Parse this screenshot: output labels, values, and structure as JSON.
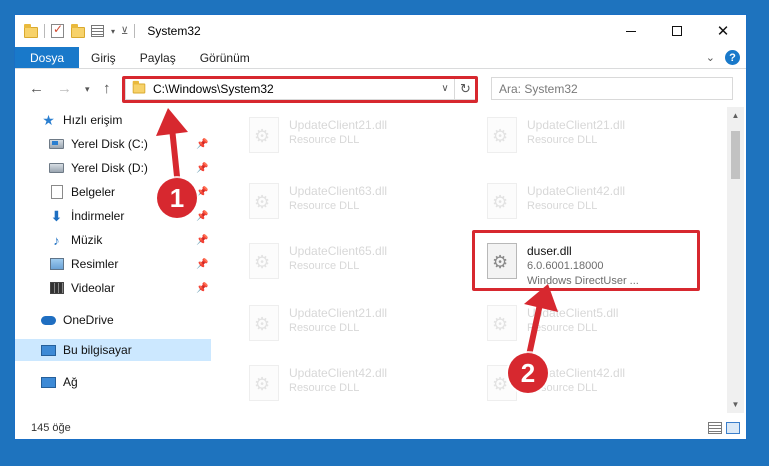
{
  "window": {
    "title": "System32"
  },
  "ribbon": {
    "tabs": [
      "Dosya",
      "Giriş",
      "Paylaş",
      "Görünüm"
    ],
    "help": "?"
  },
  "nav": {
    "address": "C:\\Windows\\System32",
    "search_placeholder": "Ara: System32"
  },
  "sidebar": {
    "quick_access": "Hızlı erişim",
    "items": [
      {
        "label": "Yerel Disk (C:)",
        "icon": "drive-icon"
      },
      {
        "label": "Yerel Disk (D:)",
        "icon": "drive-icon"
      },
      {
        "label": "Belgeler",
        "icon": "documents-icon"
      },
      {
        "label": "İndirmeler",
        "icon": "downloads-icon"
      },
      {
        "label": "Müzik",
        "icon": "music-icon"
      },
      {
        "label": "Resimler",
        "icon": "pictures-icon"
      },
      {
        "label": "Videolar",
        "icon": "videos-icon"
      }
    ],
    "onedrive": "OneDrive",
    "this_pc": "Bu bilgisayar",
    "network": "Ağ"
  },
  "files": [
    {
      "name": "UpdateClient21.dll",
      "desc": "Resource DLL"
    },
    {
      "name": "UpdateClient21.dll",
      "desc": "Resource DLL"
    },
    {
      "name": "UpdateClient63.dll",
      "desc": "Resource DLL"
    },
    {
      "name": "UpdateClient42.dll",
      "desc": "Resource DLL"
    },
    {
      "name": "UpdateClient65.dll",
      "desc": "Resource DLL"
    },
    {
      "name": "duser.dll",
      "version": "6.0.6001.18000",
      "desc": "Windows DirectUser ..."
    },
    {
      "name": "UpdateClient21.dll",
      "desc": "Resource DLL"
    },
    {
      "name": "UpdateClient5.dll",
      "desc": "Resource DLL"
    },
    {
      "name": "UpdateClient42.dll",
      "desc": "Resource DLL"
    },
    {
      "name": "UpdateClient42.dll",
      "desc": "Resource DLL"
    }
  ],
  "status": {
    "item_count": "145 öğe"
  },
  "annotations": {
    "badge1": "1",
    "badge2": "2",
    "highlight_color": "#d7282f"
  },
  "colors": {
    "accent": "#1979ca",
    "selected": "#cce8ff"
  }
}
